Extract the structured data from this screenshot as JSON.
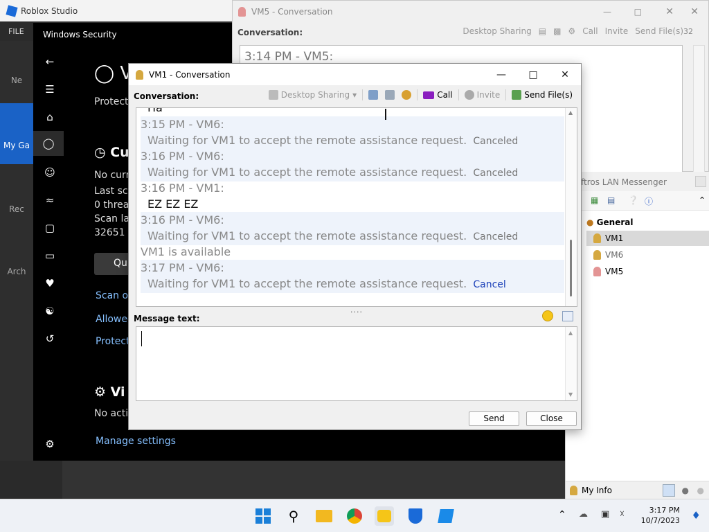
{
  "roblox": {
    "title": "Roblox Studio",
    "menu_file": "FILE",
    "side_new": "Ne",
    "side_mygames": "My Ga",
    "side_recent": "Rec",
    "side_archive": "Arch"
  },
  "security": {
    "title": "Windows Security",
    "heading_v": "V",
    "protection": "Protect",
    "current_heading": "Cu",
    "line_no_current": "No curr",
    "line_last_scan": "Last sca",
    "line_threats": "0 threa",
    "line_scan_lasted": "Scan la",
    "line_files": "32651 f",
    "quick_btn": "Qui",
    "scan_options": "Scan op",
    "allowed": "Allowed",
    "protection_history": "Protectio",
    "virus_heading": "Vi",
    "no_action": "No acti",
    "manage_settings": "Manage settings"
  },
  "vm5": {
    "title": "VM5 - Conversation",
    "conversation_label": "Conversation:",
    "desktop_sharing": "Desktop Sharing",
    "call": "Call",
    "invite": "Invite",
    "send_files": "Send File(s)",
    "badge": "32",
    "first_message": "3:14 PM - VM5:"
  },
  "lan": {
    "title": "ftros LAN Messenger",
    "group": "General",
    "users": [
      "VM1",
      "VM6",
      "VM5"
    ],
    "my_info": "My Info"
  },
  "vm1": {
    "title": "VM1 - Conversation",
    "conversation_label": "Conversation:",
    "desktop_sharing": "Desktop Sharing",
    "call": "Call",
    "invite": "Invite",
    "send_files": "Send File(s)",
    "partial_top": "Ha",
    "messages": [
      {
        "header": "3:15 PM - VM6:",
        "body": "Waiting for VM1 to accept the remote assistance request.",
        "status": "Canceled"
      },
      {
        "header": "3:16 PM - VM6:",
        "body": "Waiting for VM1 to accept the remote assistance request.",
        "status": "Canceled"
      },
      {
        "header": "3:16 PM - VM1:",
        "body": "EZ EZ EZ",
        "status": ""
      },
      {
        "header": "3:16 PM - VM6:",
        "body": "Waiting for VM1 to accept the remote assistance request.",
        "status": "Canceled"
      },
      {
        "header": "VM1 is available",
        "body": "",
        "status": ""
      },
      {
        "header": "3:17 PM - VM6:",
        "body": "Waiting for VM1 to accept the remote assistance request.",
        "status": "Cancel"
      }
    ],
    "message_label": "Message text:",
    "message_value": "",
    "send": "Send",
    "close": "Close"
  },
  "taskbar": {
    "time": "3:17 PM",
    "date": "10/7/2023"
  },
  "colors": {
    "accent_blue": "#1a62c6",
    "cancel_link": "#1a3fb8",
    "call_icon": "#8a1fbf"
  }
}
